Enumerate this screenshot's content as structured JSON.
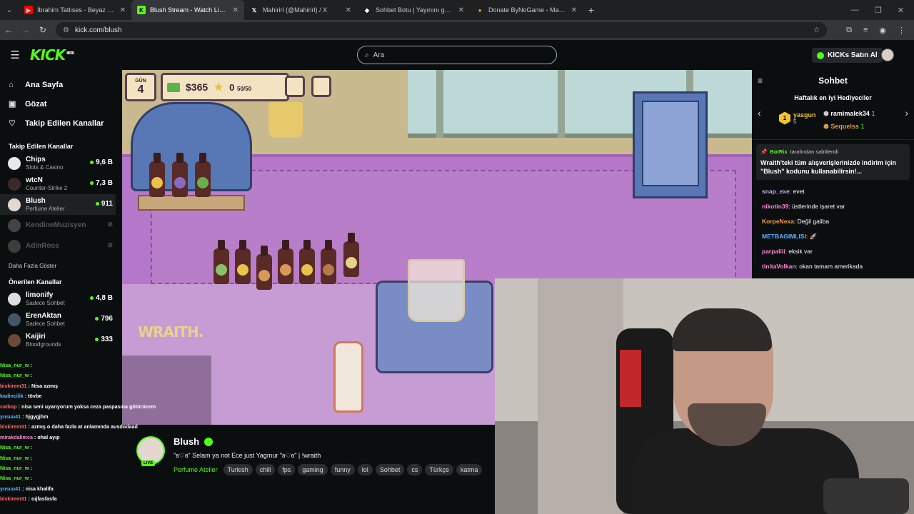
{
  "browser": {
    "tabs": [
      {
        "title": "İbrahim Tatlıses - Beyaz Mendil",
        "favicon": "youtube-icon",
        "color": "#ff0000",
        "active": false
      },
      {
        "title": "Blush Stream - Watch Live on Kick",
        "favicon": "kick-icon",
        "color": "#53fc18",
        "active": true
      },
      {
        "title": "Mahirirl (@Mahirirl) / X",
        "favicon": "x-icon",
        "color": "#ffffff",
        "active": false
      },
      {
        "title": "Sohbet Botu | Yayınını güçlendir",
        "favicon": "botrix-icon",
        "color": "#ffffff",
        "active": false
      },
      {
        "title": "Donate ByNoGame - Mahirirl D",
        "favicon": "bynogame-icon",
        "color": "#f5a623",
        "active": false
      }
    ],
    "url": "kick.com/blush"
  },
  "header": {
    "logo": "KICK",
    "logo_badge": "BETA",
    "search_placeholder": "Ara",
    "kicks_button": "KICKs Satın Al"
  },
  "sidebar": {
    "nav": [
      {
        "label": "Ana Sayfa",
        "icon": "home-icon"
      },
      {
        "label": "Gözat",
        "icon": "browse-icon"
      },
      {
        "label": "Takip Edilen Kanallar",
        "icon": "heart-icon"
      }
    ],
    "followed_heading": "Takip Edilen Kanallar",
    "followed": [
      {
        "name": "Chips",
        "game": "Slots & Casino",
        "viewers": "9,6 B",
        "live": true
      },
      {
        "name": "wtcN",
        "game": "Counter-Strike 2",
        "viewers": "7,3 B",
        "live": true
      },
      {
        "name": "Blush",
        "game": "Perfume Atelier",
        "viewers": "911",
        "live": true
      },
      {
        "name": "KendineMuzisyen",
        "game": "",
        "viewers": "",
        "live": false
      },
      {
        "name": "AdinRoss",
        "game": "",
        "viewers": "",
        "live": false
      }
    ],
    "show_more": "Daha Fazla Göster",
    "recommended_heading": "Önerilen Kanallar",
    "recommended": [
      {
        "name": "limonify",
        "game": "Sadece Sohbet",
        "viewers": "4,8 B"
      },
      {
        "name": "ErenAktan",
        "game": "Sadece Sohbet",
        "viewers": "796"
      },
      {
        "name": "Kaijiri",
        "game": "Bloodgrounds",
        "viewers": "333"
      }
    ]
  },
  "game_hud": {
    "day_label": "GÜN",
    "day": "4",
    "money": "$365",
    "reputation": "0",
    "reputation_max": "50/50",
    "watermark": "WRAITH."
  },
  "stream": {
    "name": "Blush",
    "title": "\"ʚ♡ɞ\" Selam ya not Ece just Yagmur \"ʚ♡ɞ\" | !wraith",
    "category": "Perfume Atelier",
    "tags": [
      "Turkish",
      "chill",
      "fps",
      "gaming",
      "funny",
      "lol",
      "Sohbet",
      "cs",
      "Türkçe",
      "katma"
    ],
    "live_badge": "LIVE"
  },
  "chat": {
    "title": "Sohbet",
    "gifters_title": "Haftalık en iyi Hediyeciler",
    "gifters": [
      {
        "rank": "1",
        "name": "yasgun",
        "count": "5"
      },
      {
        "name": "ramimalek34",
        "count": "1"
      },
      {
        "name": "Sequelss",
        "count": "1"
      }
    ],
    "pinned_by": "BotRix",
    "pinned_suffix": "tarafından sabitlendi",
    "pinned_text": "Wraith'teki tüm alışverişlerinizde indirim için \"Blush\" kodunu kullanabilirsin!...",
    "messages": [
      {
        "user": "snap_exe",
        "color": "#c9a6ff",
        "text": "evet"
      },
      {
        "user": "nikotin39",
        "color": "#ff8ad8",
        "text": "üstlerinde işaret var"
      },
      {
        "user": "KorpeNexa",
        "color": "#ff9a3c",
        "text": "Değil galiba"
      },
      {
        "user": "METBAGIMLISI",
        "color": "#5fb3ff",
        "text": "🚀"
      },
      {
        "user": "parpaliii",
        "color": "#ff8ad8",
        "text": "eksik var"
      },
      {
        "user": "tinitaVolkan",
        "color": "#ff8ad8",
        "text": "okan tamam amerikada"
      }
    ]
  },
  "overlay_chat": [
    {
      "user": "Nisa_nur_w",
      "color": "#53fc18",
      "text": ""
    },
    {
      "user": "Nisa_nur_w",
      "color": "#53fc18",
      "text": ""
    },
    {
      "user": "biskirem31",
      "color": "#ff6b6b",
      "text": "Nisa azmış"
    },
    {
      "user": "kadincilik",
      "color": "#5fb3ff",
      "text": "tövbe"
    },
    {
      "user": "catbop",
      "color": "#ff6b6b",
      "text": "nisa seni uyarıyorum yoksa ceza paspasına götürücem"
    },
    {
      "user": "yusuu41",
      "color": "#5fb3ff",
      "text": "hjgygjhm"
    },
    {
      "user": "biskirem31",
      "color": "#ff6b6b",
      "text": "azmış o daha fazla at anlamında ausdodaad"
    },
    {
      "user": "mirakdalimca",
      "color": "#ff8ad8",
      "text": "ohal ayıp"
    },
    {
      "user": "Nisa_nur_w",
      "color": "#53fc18",
      "text": ""
    },
    {
      "user": "Nisa_nur_w",
      "color": "#53fc18",
      "text": ""
    },
    {
      "user": "Nisa_nur_w",
      "color": "#53fc18",
      "text": ""
    },
    {
      "user": "Nisa_nur_w",
      "color": "#53fc18",
      "text": ""
    },
    {
      "user": "yusuu41",
      "color": "#5fb3ff",
      "text": "nisa khalifa"
    },
    {
      "user": "biskirem31",
      "color": "#ff6b6b",
      "text": "oıjfasfasfa"
    }
  ],
  "colors": {
    "accent": "#53fc18",
    "bg": "#0b0e0f"
  }
}
